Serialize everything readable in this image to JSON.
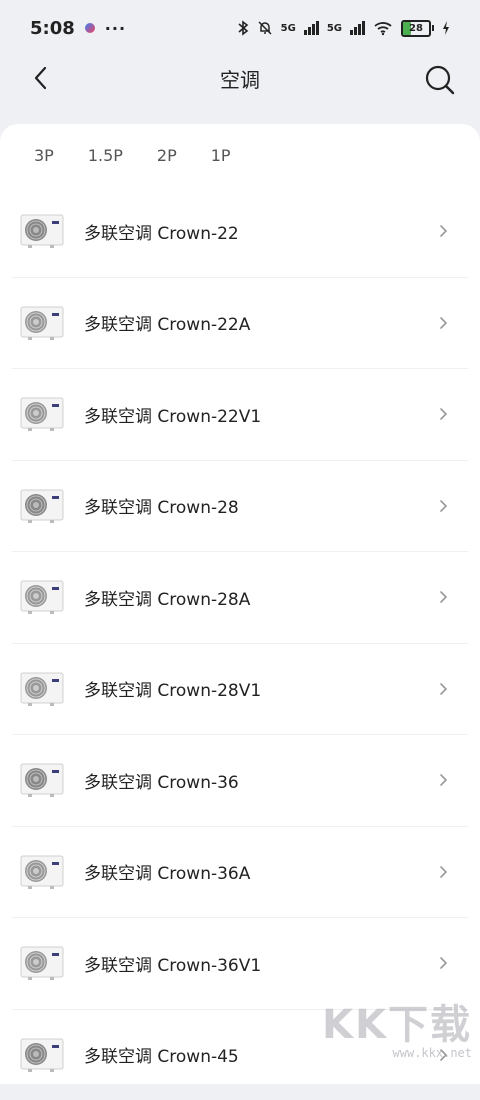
{
  "status_bar": {
    "time": "5:08",
    "more_dots": "···",
    "network_1": "5G",
    "network_2": "5G",
    "battery_level": "28"
  },
  "header": {
    "title": "空调"
  },
  "filters": [
    "3P",
    "1.5P",
    "2P",
    "1P"
  ],
  "items": [
    "多联空调 Crown-22",
    "多联空调 Crown-22A",
    "多联空调 Crown-22V1",
    "多联空调 Crown-28",
    "多联空调 Crown-28A",
    "多联空调 Crown-28V1",
    "多联空调 Crown-36",
    "多联空调 Crown-36A",
    "多联空调 Crown-36V1",
    "多联空调 Crown-45"
  ],
  "watermark": {
    "logo": "KK下载",
    "url": "www.kkx.net"
  },
  "colors": {
    "background": "#eff0f4",
    "card": "#ffffff",
    "battery_fill": "#4caf50"
  }
}
